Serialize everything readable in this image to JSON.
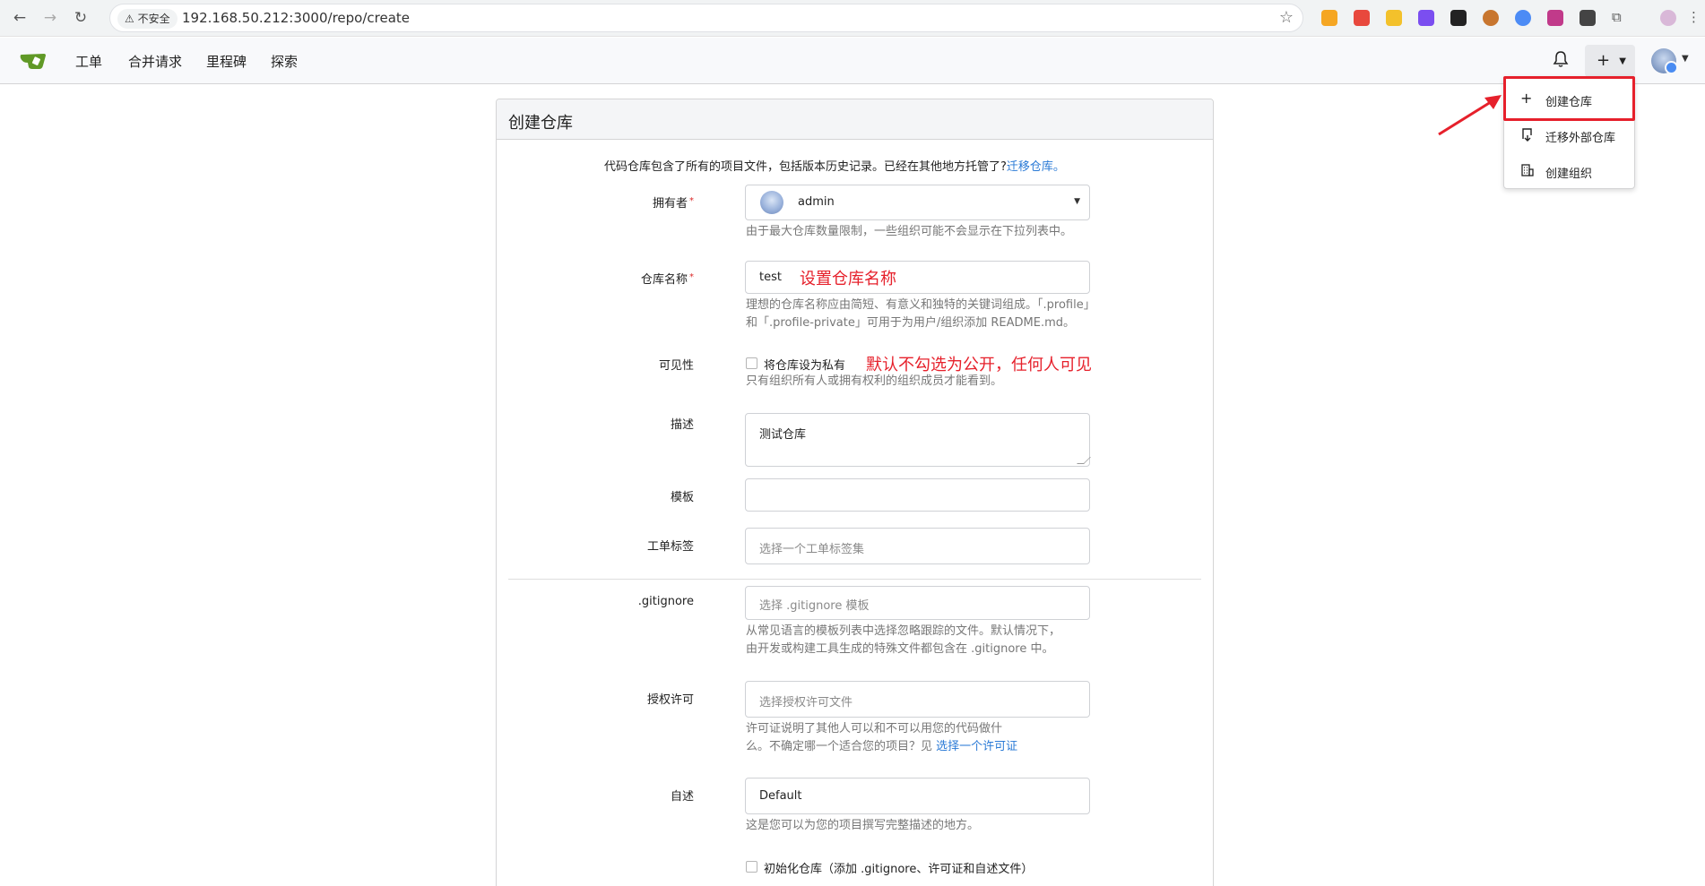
{
  "browser": {
    "insecure_label": "不安全",
    "url": "192.168.50.212:3000/repo/create"
  },
  "header": {
    "nav": [
      "工单",
      "合并请求",
      "里程碑",
      "探索"
    ]
  },
  "create_menu": {
    "items": [
      "创建仓库",
      "迁移外部仓库",
      "创建组织"
    ]
  },
  "form": {
    "title": "创建仓库",
    "intro_text": "代码仓库包含了所有的项目文件，包括版本历史记录。已经在其他地方托管了?",
    "intro_link": "迁移仓库。",
    "owner": {
      "label": "拥有者",
      "value": "admin",
      "help": "由于最大仓库数量限制，一些组织可能不会显示在下拉列表中。"
    },
    "repo_name": {
      "label": "仓库名称",
      "value": "test",
      "annotation": "设置仓库名称",
      "help_line1": "理想的仓库名称应由简短、有意义和独特的关键词组成。「.profile」",
      "help_line2": "和「.profile-private」可用于为用户/组织添加 README.md。"
    },
    "visibility": {
      "label": "可见性",
      "checkbox_label": "将仓库设为私有",
      "annotation": "默认不勾选为公开，任何人可见",
      "help": "只有组织所有人或拥有权利的组织成员才能看到。"
    },
    "description": {
      "label": "描述",
      "value": "测试仓库"
    },
    "template": {
      "label": "模板",
      "value": ""
    },
    "issue_labels": {
      "label": "工单标签",
      "placeholder": "选择一个工单标签集"
    },
    "gitignore": {
      "label": ".gitignore",
      "placeholder": "选择 .gitignore 模板",
      "help_line1": "从常见语言的模板列表中选择忽略跟踪的文件。默认情况下，",
      "help_line2": "由开发或构建工具生成的特殊文件都包含在 .gitignore 中。"
    },
    "license": {
      "label": "授权许可",
      "placeholder": "选择授权许可文件",
      "help_line1": "许可证说明了其他人可以和不可以用您的代码做什",
      "help_line2": "么。不确定哪一个适合您的项目？见",
      "help_link": "选择一个许可证"
    },
    "readme": {
      "label": "自述",
      "value": "Default",
      "help": "这是您可以为您的项目撰写完整描述的地方。"
    },
    "init": {
      "checkbox_label": "初始化仓库（添加 .gitignore、许可证和自述文件）"
    }
  },
  "colors": {
    "accent_red": "#e6202b",
    "link_blue": "#2a7ad6",
    "gitea_green": "#609926"
  }
}
